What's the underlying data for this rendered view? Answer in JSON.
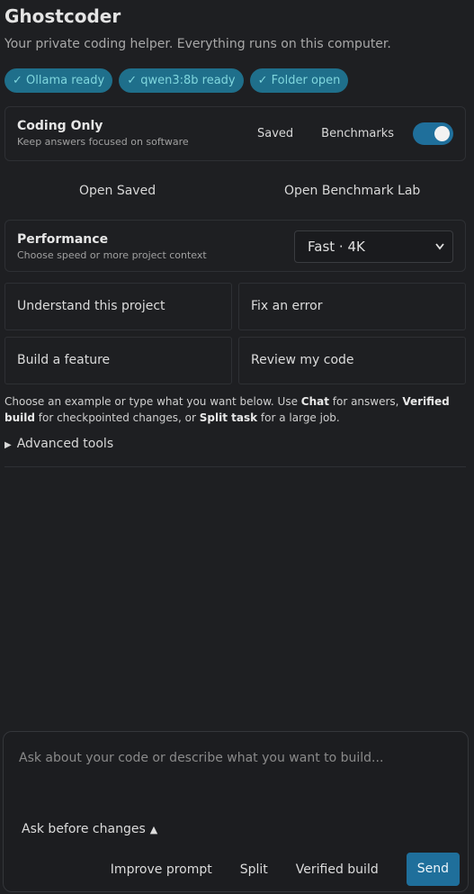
{
  "header": {
    "title": "Ghostcoder",
    "subtitle": "Your private coding helper. Everything runs on this computer."
  },
  "badges": [
    "✓ Ollama ready",
    "✓ qwen3:8b ready",
    "✓ Folder open"
  ],
  "mode": {
    "title": "Coding Only",
    "subtitle": "Keep answers focused on software",
    "saved_label": "Saved",
    "benchmarks_label": "Benchmarks",
    "toggle_on": true
  },
  "links": {
    "open_saved": "Open Saved",
    "open_benchmark": "Open Benchmark Lab"
  },
  "performance": {
    "title": "Performance",
    "subtitle": "Choose speed or more project context",
    "selected": "Fast · 4K"
  },
  "examples": [
    "Understand this project",
    "Fix an error",
    "Build a feature",
    "Review my code"
  ],
  "help": {
    "p1": "Choose an example or type what you want below. Use ",
    "chat": "Chat",
    "p2": " for answers, ",
    "verified": "Verified build",
    "p3": " for checkpointed changes, or ",
    "split": "Split task",
    "p4": " for a large job."
  },
  "advanced": {
    "label": "Advanced tools"
  },
  "composer": {
    "placeholder": "Ask about your code or describe what you want to build...",
    "ask_label": "Ask before changes",
    "improve": "Improve prompt",
    "split": "Split",
    "verified": "Verified build",
    "send": "Send"
  },
  "colors": {
    "accent": "#1f6f9b",
    "badge_bg": "#1f6f8b",
    "badge_text": "#7fd6dd",
    "bg": "#1e1f22"
  }
}
